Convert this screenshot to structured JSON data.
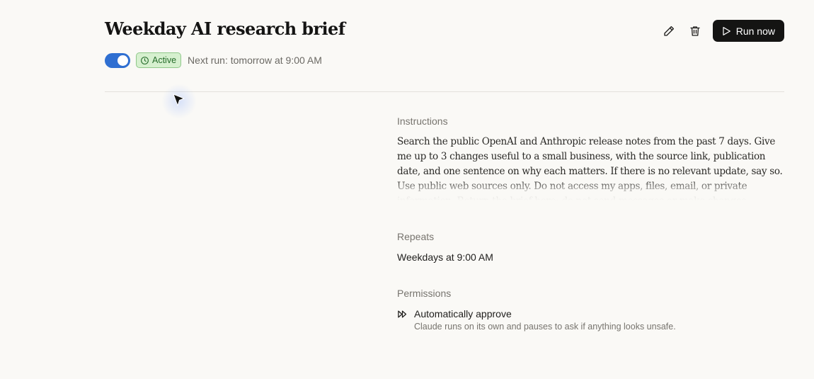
{
  "header": {
    "title": "Weekday AI research brief",
    "run_label": "Run now",
    "icons": [
      "pencil-icon",
      "trash-icon",
      "play-icon"
    ]
  },
  "status": {
    "enabled": true,
    "badge_label": "Active",
    "next_run": "Next run: tomorrow at 9:00 AM"
  },
  "details": {
    "instructions_label": "Instructions",
    "instructions_text": "Search the public OpenAI and Anthropic release notes from the past 7 days. Give me up to 3 changes useful to a small business, with the source link, publication date, and one sentence on why each matters. If there is no relevant update, say so. Use public web sources only. Do not access my apps, files, email, or private information. Return the brief here; do not send messages or make changes elsewhere.",
    "repeats_label": "Repeats",
    "repeats_value": "Weekdays at 9:00 AM",
    "permissions_label": "Permissions",
    "permission_title": "Automatically approve",
    "permission_desc": "Claude runs on its own and pauses to ask if anything looks unsafe."
  },
  "colors": {
    "toggle_on": "#2f6fd1",
    "badge_bg": "#d6f0cf",
    "badge_text": "#256b2a",
    "run_button_bg": "#141413",
    "background": "#faf9f6"
  }
}
